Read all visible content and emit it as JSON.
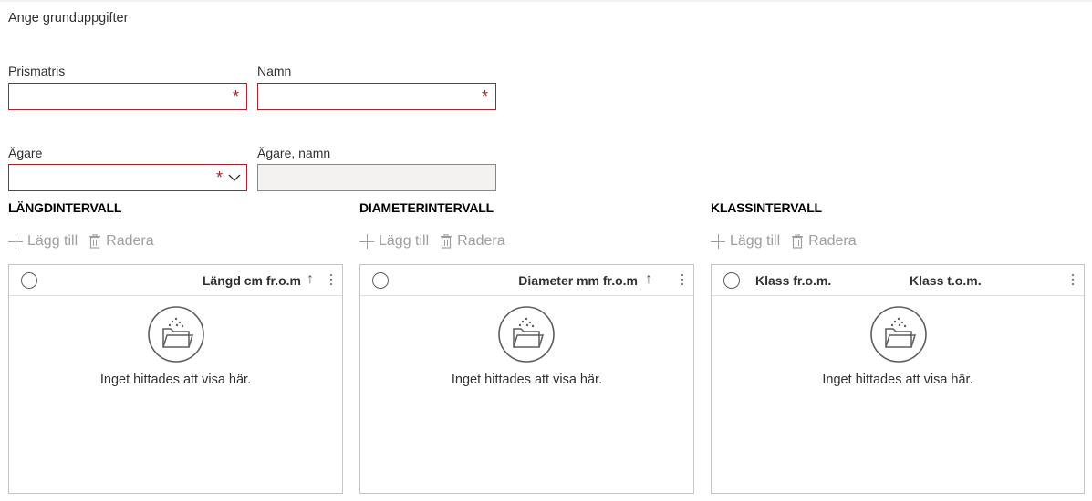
{
  "header": {
    "title": "Ange grunduppgifter"
  },
  "form": {
    "prismatris": {
      "label": "Prismatris",
      "value": "",
      "required_mark": "*"
    },
    "namn": {
      "label": "Namn",
      "value": "",
      "required_mark": "*"
    },
    "agare": {
      "label": "Ägare",
      "value": "",
      "required_mark": "*"
    },
    "agare_namn": {
      "label": "Ägare, namn",
      "value": ""
    }
  },
  "toolbar": {
    "add_label": "Lägg till",
    "delete_label": "Radera"
  },
  "grids": {
    "langd": {
      "title": "LÄNGDINTERVALL",
      "columns": [
        "Längd cm fr.o.m"
      ],
      "sort_indicator": "↑",
      "empty_text": "Inget hittades att visa här."
    },
    "diameter": {
      "title": "DIAMETERINTERVALL",
      "columns": [
        "Diameter mm fr.o.m"
      ],
      "sort_indicator": "↑",
      "empty_text": "Inget hittades att visa här."
    },
    "klass": {
      "title": "KLASSINTERVALL",
      "columns": [
        "Klass fr.o.m.",
        "Klass t.o.m."
      ],
      "empty_text": "Inget hittades att visa här."
    }
  },
  "colors": {
    "required": "#a4262c",
    "disabled_text": "#a19f9d",
    "border": "#c8c6c4"
  }
}
